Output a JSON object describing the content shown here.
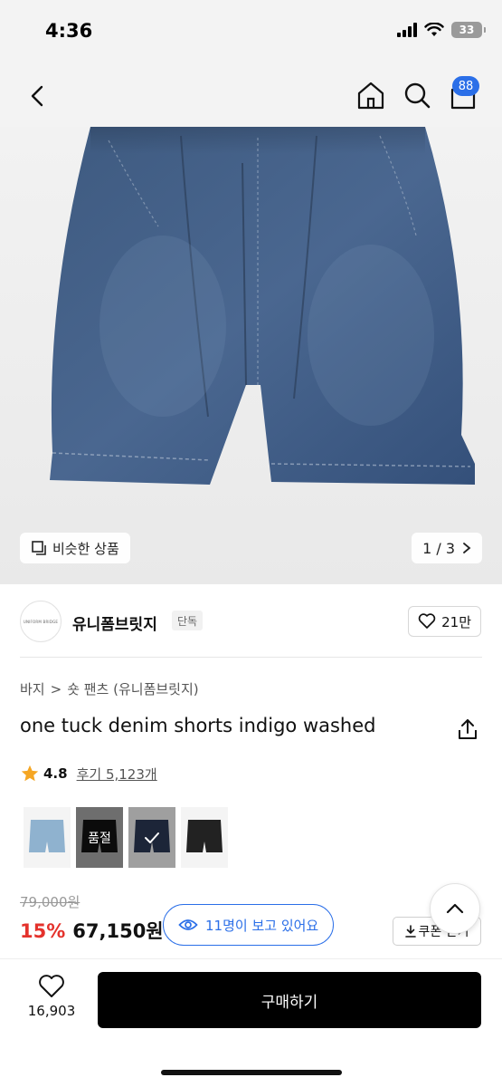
{
  "status_bar": {
    "time": "4:36",
    "battery": "33"
  },
  "nav": {
    "cart_count": "88",
    "icons": [
      "back-icon",
      "home-icon",
      "search-icon",
      "cart-icon"
    ]
  },
  "gallery": {
    "similar_label": "비슷한 상품",
    "page": "1 / 3"
  },
  "brand": {
    "logo_text": "UNIFORM BRIDGE",
    "name": "유니폼브릿지",
    "tag": "단독",
    "likes": "21만"
  },
  "breadcrumb": {
    "category": "바지",
    "separator": ">",
    "subcategory": "숏 팬츠 (유니폼브릿지)"
  },
  "product": {
    "title": "one tuck denim shorts indigo washed",
    "rating": "4.8",
    "reviews": "후기 5,123개"
  },
  "swatches": [
    {
      "color": "#8fb2cf",
      "sold_out": "",
      "selected": false
    },
    {
      "color": "#1a1a1a",
      "sold_out": "품절",
      "selected": false
    },
    {
      "color": "#2c3a56",
      "sold_out": "",
      "selected": true
    },
    {
      "color": "#222222",
      "sold_out": "",
      "selected": false
    }
  ],
  "price": {
    "original": "79,000원",
    "discount": "15%",
    "final": "67,150원",
    "viewers": "11명이 보고 있어요",
    "coupon": "쿠폰 받기"
  },
  "bottom": {
    "wish_count": "16,903",
    "buy_label": "구매하기"
  },
  "colors": {
    "accent_blue": "#2b6fe8",
    "discount_red": "#e4322c",
    "star": "#f5a623"
  }
}
